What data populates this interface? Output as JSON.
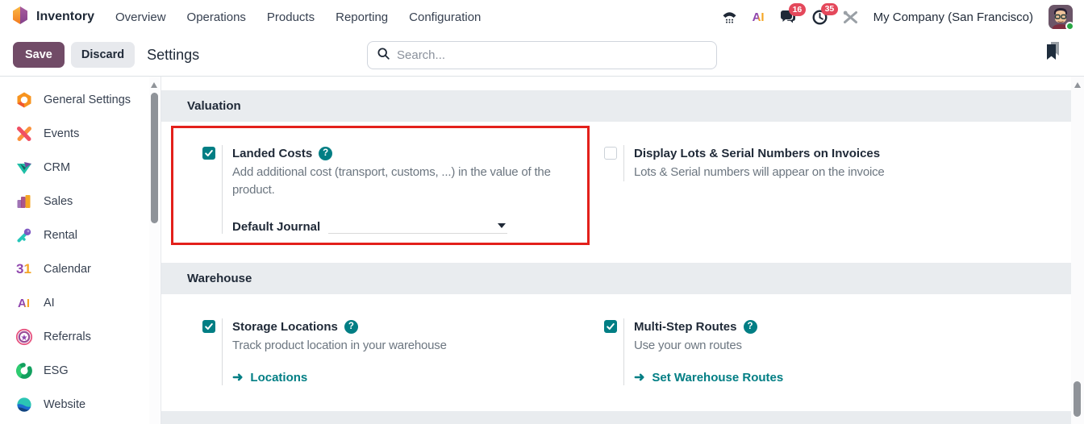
{
  "app": {
    "name": "Inventory"
  },
  "nav": {
    "items": [
      "Overview",
      "Operations",
      "Products",
      "Reporting",
      "Configuration"
    ]
  },
  "systray": {
    "messages_badge": "16",
    "activities_badge": "35",
    "company": "My Company (San Francisco)"
  },
  "control_panel": {
    "save_label": "Save",
    "discard_label": "Discard",
    "title": "Settings",
    "search_placeholder": "Search..."
  },
  "sidebar": {
    "items": [
      {
        "label": "General Settings"
      },
      {
        "label": "Events"
      },
      {
        "label": "CRM"
      },
      {
        "label": "Sales"
      },
      {
        "label": "Rental"
      },
      {
        "label": "Calendar",
        "icon_text": "31"
      },
      {
        "label": "AI",
        "icon_text": "AI"
      },
      {
        "label": "Referrals"
      },
      {
        "label": "ESG"
      },
      {
        "label": "Website"
      }
    ]
  },
  "settings": {
    "valuation": {
      "title": "Valuation",
      "landed_costs": {
        "label": "Landed Costs",
        "checked": true,
        "description": "Add additional cost (transport, customs, ...) in the value of the product.",
        "field_label": "Default Journal",
        "field_value": ""
      },
      "display_lots": {
        "label": "Display Lots & Serial Numbers on Invoices",
        "checked": false,
        "description": "Lots & Serial numbers will appear on the invoice"
      }
    },
    "warehouse": {
      "title": "Warehouse",
      "storage_locations": {
        "label": "Storage Locations",
        "checked": true,
        "description": "Track product location in your warehouse",
        "link": "Locations"
      },
      "multi_step_routes": {
        "label": "Multi-Step Routes",
        "checked": true,
        "description": "Use your own routes",
        "link": "Set Warehouse Routes"
      }
    }
  },
  "icons": {
    "help": "?",
    "star": "★",
    "arrow_right": "➜"
  },
  "colors": {
    "accent_teal": "#017e84",
    "save_purple": "#714b67",
    "annotation_red": "#e3201b",
    "badge_red": "#e4485b",
    "section_band": "#e9ecef"
  }
}
